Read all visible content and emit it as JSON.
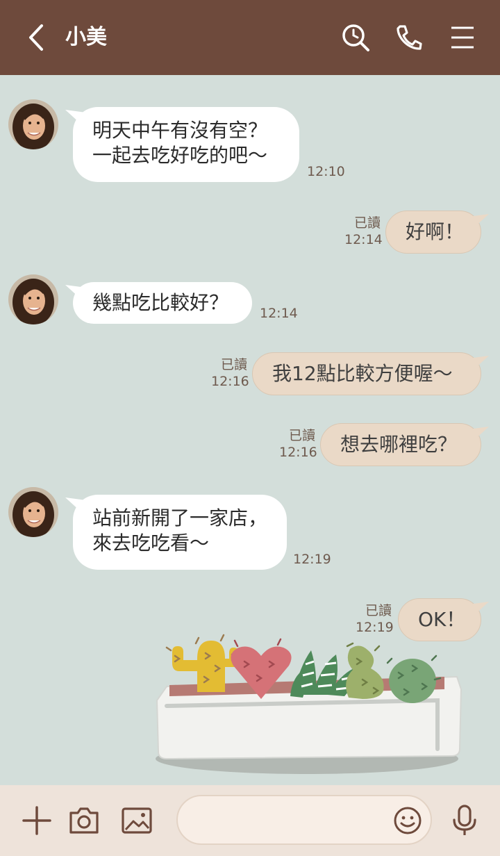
{
  "header": {
    "title": "小美"
  },
  "messages": [
    {
      "id": 1,
      "direction": "in",
      "lines": [
        "明天中午有沒有空？",
        "一起去吃好吃的吧〜"
      ],
      "time": "12:10"
    },
    {
      "id": 2,
      "direction": "out",
      "lines": [
        "好啊！"
      ],
      "read": "已讀",
      "time": "12:14"
    },
    {
      "id": 3,
      "direction": "in",
      "lines": [
        "幾點吃比較好？"
      ],
      "time": "12:14"
    },
    {
      "id": 4,
      "direction": "out",
      "lines": [
        "我12點比較方便喔〜"
      ],
      "read": "已讀",
      "time": "12:16"
    },
    {
      "id": 5,
      "direction": "out",
      "lines": [
        "想去哪裡吃？"
      ],
      "read": "已讀",
      "time": "12:16"
    },
    {
      "id": 6,
      "direction": "in",
      "lines": [
        "站前新開了一家店，",
        "來去吃吃看〜"
      ],
      "time": "12:19"
    },
    {
      "id": 7,
      "direction": "out",
      "lines": [
        "OK！"
      ],
      "read": "已讀",
      "time": "12:19"
    }
  ],
  "footer": {
    "input_placeholder": ""
  },
  "colors": {
    "header": "#6E4A3C",
    "background": "#D3DEDA",
    "outgoing_bubble": "#EAD9C7",
    "incoming_bubble": "#FFFFFF",
    "footer": "#EEE3DA"
  },
  "icons": [
    "back-icon",
    "search-icon",
    "phone-icon",
    "menu-icon",
    "plus-icon",
    "camera-icon",
    "image-icon",
    "emoji-icon",
    "microphone-icon"
  ]
}
